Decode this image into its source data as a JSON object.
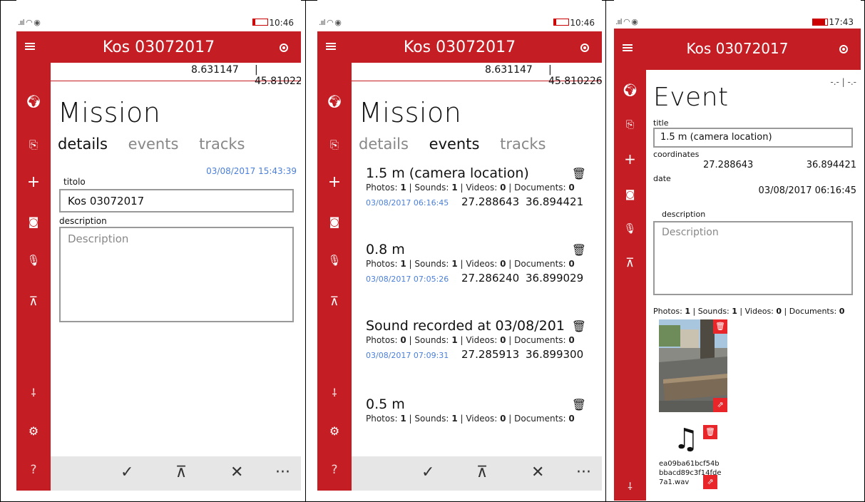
{
  "status": {
    "signal_glyph": ".ııl ◠ ◉",
    "time_1": "10:46",
    "time_2": "10:46",
    "time_3": "17:43"
  },
  "app": {
    "title": "Kos 03072017"
  },
  "sidebar": {
    "icons": [
      "globe-icon",
      "map-icon",
      "add-icon",
      "camera-icon",
      "microphone-icon",
      "upload-icon",
      "hiker-icon",
      "settings-icon",
      "help-icon"
    ]
  },
  "mission": {
    "lon": "8.631147",
    "lat": "| 45.810226",
    "heading": "Mission",
    "tabs": [
      "details",
      "events",
      "tracks"
    ],
    "datetime": "03/08/2017 15:43:39",
    "title_label": "titolo",
    "title_value": "Kos 03072017",
    "description_label": "description",
    "description_placeholder": "Description"
  },
  "commands": {
    "accept": "✓",
    "upload": "⊼",
    "close": "✕",
    "more": "···"
  },
  "events_list": [
    {
      "title": "1.5 m (camera location)",
      "photos": "1",
      "sounds": "1",
      "videos": "0",
      "documents": "0",
      "date": "03/08/2017 06:16:45",
      "lat": "27.288643",
      "lon": "36.894421"
    },
    {
      "title": "0.8 m",
      "photos": "1",
      "sounds": "1",
      "videos": "0",
      "documents": "0",
      "date": "03/08/2017 07:05:26",
      "lat": "27.286240",
      "lon": "36.899029"
    },
    {
      "title": "Sound recorded at 03/08/201",
      "photos": "0",
      "sounds": "1",
      "videos": "0",
      "documents": "0",
      "date": "03/08/2017 07:09:31",
      "lat": "27.285913",
      "lon": "36.899300"
    },
    {
      "title": "0.5 m",
      "photos": "1",
      "sounds": "1",
      "videos": "0",
      "documents": "0",
      "date": "",
      "lat": "",
      "lon": ""
    }
  ],
  "stats_labels": {
    "photos": "Photos:",
    "sounds": "Sounds:",
    "videos": "Videos:",
    "documents": "Documents:"
  },
  "event": {
    "coords_top": "-.- | -.-",
    "heading": "Event",
    "title_label": "title",
    "title_value": "1.5 m (camera location)",
    "coordinates_label": "coordinates",
    "lat": "27.288643",
    "lon": "36.894421",
    "date_label": "date",
    "date_value": "03/08/2017 06:16:45",
    "description_label": "description",
    "description_placeholder": "Description",
    "photos": "1",
    "sounds": "1",
    "videos": "0",
    "documents": "0",
    "sound_file": "ea09ba61bcf54b bbacd89c3f14fde 7a1.wav"
  }
}
